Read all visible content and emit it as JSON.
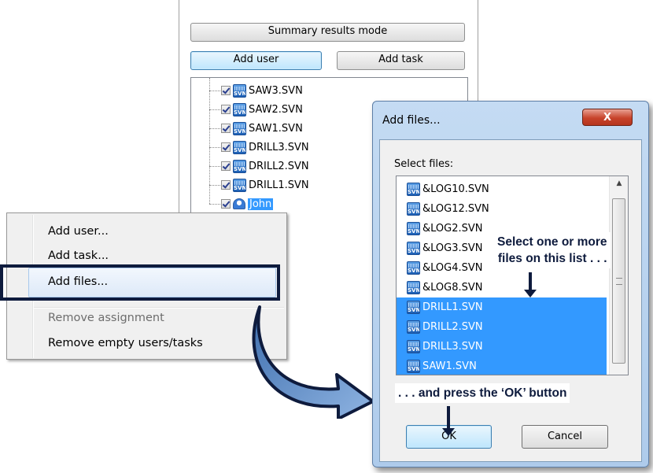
{
  "panel": {
    "summary_button": "Summary results mode",
    "add_user_button": "Add user",
    "add_task_button": "Add task",
    "tree_items": [
      "SAW3.SVN",
      "SAW2.SVN",
      "SAW1.SVN",
      "DRILL3.SVN",
      "DRILL2.SVN",
      "DRILL1.SVN"
    ],
    "user_item": "John"
  },
  "context_menu": {
    "items": [
      "Add user...",
      "Add task...",
      "Add files...",
      "Remove assignment",
      "Remove empty users/tasks"
    ],
    "disabled_item": "Remove assignment",
    "highlighted_item": "Add files..."
  },
  "dialog": {
    "title": "Add files...",
    "close_label": "X",
    "select_label": "Select files:",
    "files": [
      {
        "name": "&LOG10.SVN",
        "selected": false
      },
      {
        "name": "&LOG12.SVN",
        "selected": false
      },
      {
        "name": "&LOG2.SVN",
        "selected": false
      },
      {
        "name": "&LOG3.SVN",
        "selected": false
      },
      {
        "name": "&LOG4.SVN",
        "selected": false
      },
      {
        "name": "&LOG8.SVN",
        "selected": false
      },
      {
        "name": "DRILL1.SVN",
        "selected": true
      },
      {
        "name": "DRILL2.SVN",
        "selected": true
      },
      {
        "name": "DRILL3.SVN",
        "selected": true
      },
      {
        "name": "SAW1.SVN",
        "selected": true
      }
    ],
    "ok_button": "OK",
    "cancel_button": "Cancel"
  },
  "callouts": {
    "select_line1": "Select one or more",
    "select_line2": "files on this list . . .",
    "press_ok": ". . . and press the ‘OK’ button"
  },
  "icons": {
    "file_icon": "svn-file-icon",
    "user_icon": "user-icon"
  },
  "colors": {
    "selection": "#3399ff",
    "callout": "#0e1b3d",
    "dialog_frame": "#aecbeb"
  }
}
